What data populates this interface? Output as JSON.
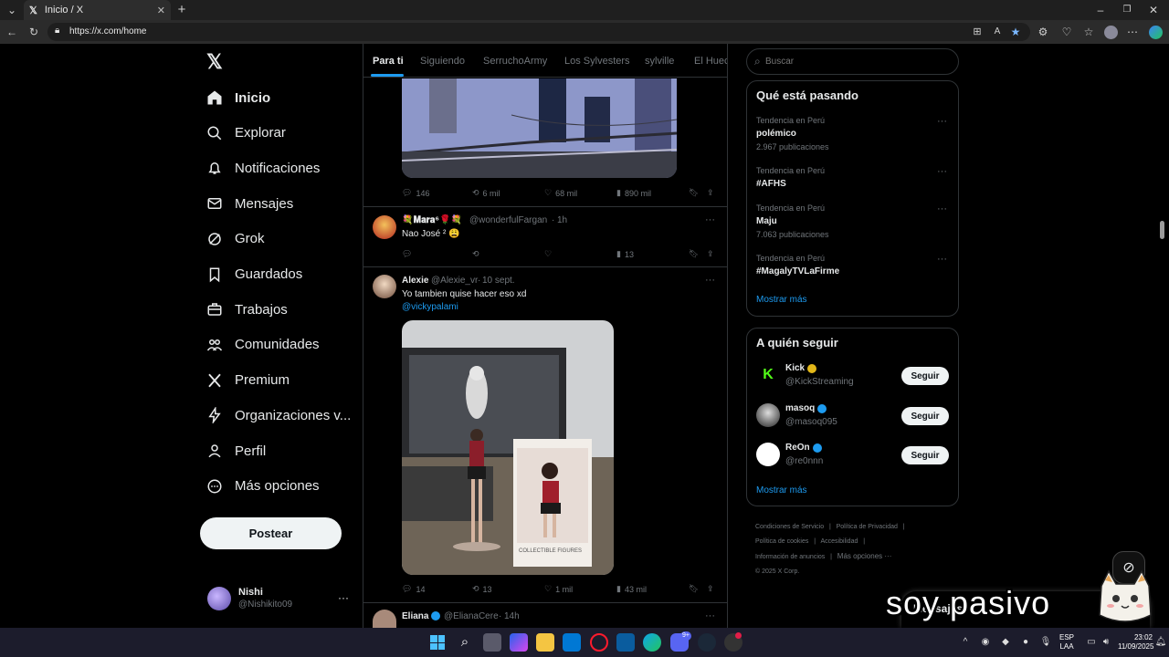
{
  "browser": {
    "tab_title": "Inicio / X",
    "url": "https://x.com/home"
  },
  "sidebar": {
    "items": [
      {
        "label": "Inicio",
        "icon": "home-icon",
        "active": true
      },
      {
        "label": "Explorar",
        "icon": "search-icon"
      },
      {
        "label": "Notificaciones",
        "icon": "bell-icon"
      },
      {
        "label": "Mensajes",
        "icon": "mail-icon"
      },
      {
        "label": "Grok",
        "icon": "grok-icon"
      },
      {
        "label": "Guardados",
        "icon": "bookmark-icon"
      },
      {
        "label": "Trabajos",
        "icon": "briefcase-icon"
      },
      {
        "label": "Comunidades",
        "icon": "people-icon"
      },
      {
        "label": "Premium",
        "icon": "x-logo-icon"
      },
      {
        "label": "Organizaciones v...",
        "icon": "lightning-icon"
      },
      {
        "label": "Perfil",
        "icon": "person-icon"
      },
      {
        "label": "Más opciones",
        "icon": "more-circle-icon"
      }
    ],
    "post_label": "Postear",
    "account": {
      "name": "Nishi",
      "handle": "@Nishikito09"
    }
  },
  "feed": {
    "tabs": [
      "Para ti",
      "Siguiendo",
      "SerruchoArmy",
      "Los Sylvesters",
      "sylville",
      "El Hueco"
    ],
    "post1": {
      "replies": "146",
      "reposts": "6 mil",
      "likes": "68 mil",
      "views": "890 mil"
    },
    "post2": {
      "name": "💐𝐌𝐚𝐫𝐚⁶🌹💐",
      "handle": "@wonderfulFargan",
      "time": "1h",
      "text": "Nao José ² 😩",
      "views": "13"
    },
    "post3": {
      "name": "Alexie",
      "handle": "@Alexie_vr",
      "time": "10 sept.",
      "text": "Yo tambien quise hacer eso xd",
      "mention": "@vickypalami",
      "replies": "14",
      "reposts": "13",
      "likes": "1 mil",
      "views": "43 mil",
      "box_label": "COLLECTIBLE FIGURES"
    },
    "post4": {
      "name": "Eliana",
      "handle": "@ElianaCere",
      "time": "14h"
    }
  },
  "right": {
    "search_placeholder": "Buscar",
    "trends_title": "Qué está pasando",
    "trends": [
      {
        "context": "Tendencia en Perú",
        "name": "polémico",
        "count": "2.967 publicaciones"
      },
      {
        "context": "Tendencia en Perú",
        "name": "#AFHS",
        "count": ""
      },
      {
        "context": "Tendencia en Perú",
        "name": "Maju",
        "count": "7.063 publicaciones"
      },
      {
        "context": "Tendencia en Perú",
        "name": "#MagalyTVLaFirme",
        "count": ""
      }
    ],
    "show_more": "Mostrar más",
    "who_title": "A quién seguir",
    "who": [
      {
        "name": "Kick",
        "handle": "@KickStreaming",
        "btn": "Seguir"
      },
      {
        "name": "masoq",
        "handle": "@masoq095",
        "btn": "Seguir"
      },
      {
        "name": "ReOn",
        "handle": "@re0nnn",
        "btn": "Seguir"
      }
    ],
    "footer": [
      "Condiciones de Servicio",
      "|",
      "Política de Privacidad",
      "|",
      "Política de cookies",
      "|",
      "Accesibilidad",
      "|",
      "Información de anuncios",
      "|",
      "Más opciones ···",
      "© 2025 X Corp."
    ]
  },
  "overlay": {
    "caption": "soy pasivo",
    "messages_label": "Mensajes"
  },
  "taskbar": {
    "lang1": "ESP",
    "lang2": "LAA",
    "time": "23:02",
    "date": "11/09/2025",
    "discord_badge": "9+"
  }
}
